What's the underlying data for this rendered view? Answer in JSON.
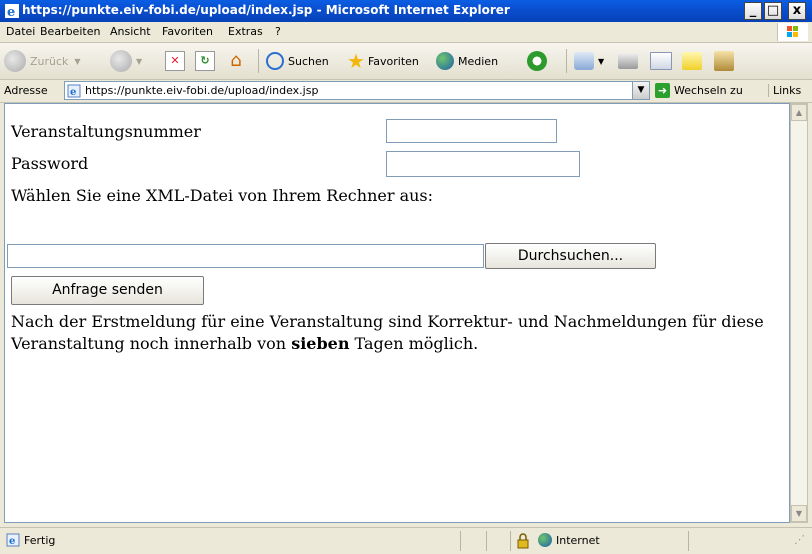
{
  "window": {
    "title": "https://punkte.eiv-fobi.de/upload/index.jsp - Microsoft Internet Explorer"
  },
  "menu": {
    "items": [
      "Datei",
      "Bearbeiten",
      "Ansicht",
      "Favoriten",
      "Extras",
      "?"
    ]
  },
  "toolbar": {
    "back": "Zurück",
    "search": "Suchen",
    "favorites": "Favoriten",
    "media": "Medien"
  },
  "address": {
    "label": "Adresse",
    "url": "https://punkte.eiv-fobi.de/upload/index.jsp",
    "go": "Wechseln zu",
    "links": "Links"
  },
  "form": {
    "event_label": "Veranstaltungsnummer",
    "event_value": "",
    "password_label": "Password",
    "password_value": "",
    "file_label": "Wählen Sie eine XML-Datei von Ihrem Rechner aus:",
    "file_value": "",
    "browse_button": "Durchsuchen...",
    "submit_button": "Anfrage senden"
  },
  "notice": {
    "part1": "Nach der Erstmeldung für eine Veranstaltung sind Korrektur- und Nachmeldungen für diese Veranstaltung noch innerhalb von ",
    "bold": "sieben",
    "part2": " Tagen möglich."
  },
  "status": {
    "left": "Fertig",
    "zone": "Internet"
  }
}
